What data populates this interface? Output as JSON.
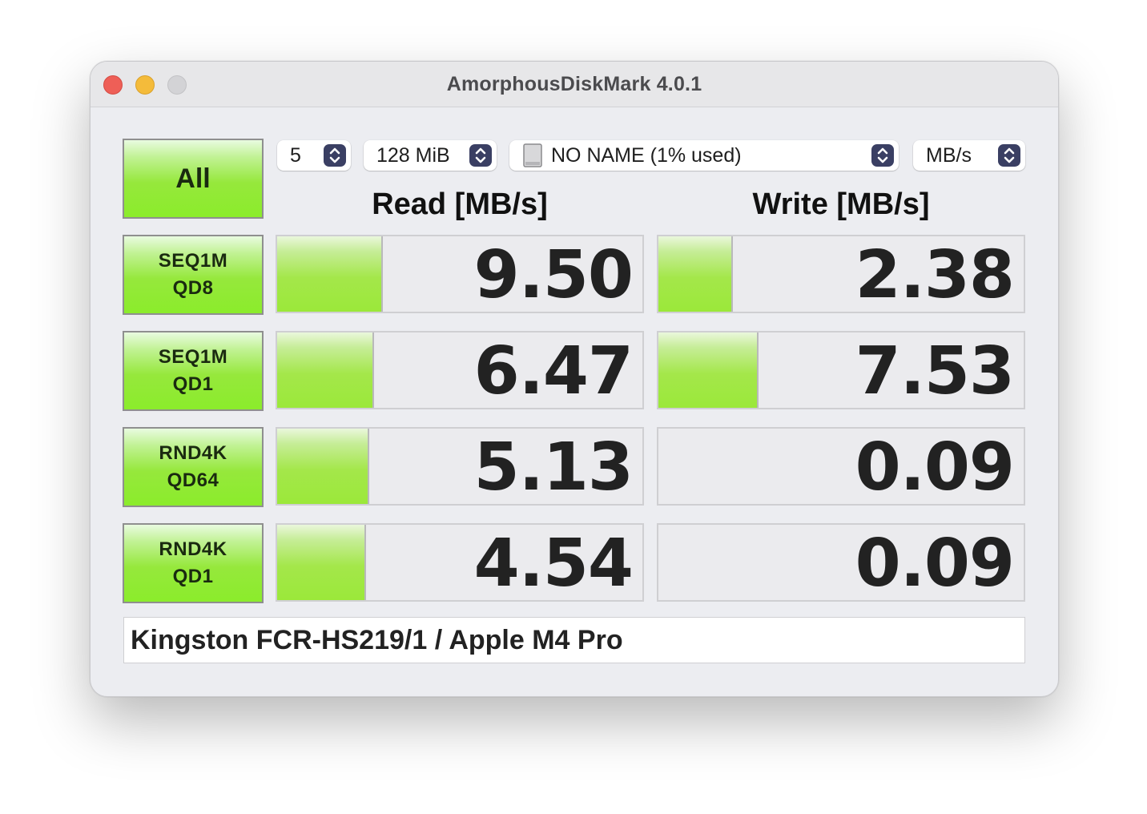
{
  "window": {
    "title": "AmorphousDiskMark 4.0.1"
  },
  "controls": {
    "all_label": "All",
    "count": "5",
    "size": "128 MiB",
    "drive": "NO NAME (1% used)",
    "unit": "MB/s"
  },
  "headers": {
    "read": "Read [MB/s]",
    "write": "Write [MB/s]"
  },
  "tests": [
    {
      "line1": "SEQ1M",
      "line2": "QD8",
      "read": "9.50",
      "write": "2.38",
      "read_fill": 0.285,
      "write_fill": 0.2
    },
    {
      "line1": "SEQ1M",
      "line2": "QD1",
      "read": "6.47",
      "write": "7.53",
      "read_fill": 0.262,
      "write_fill": 0.27
    },
    {
      "line1": "RND4K",
      "line2": "QD64",
      "read": "5.13",
      "write": "0.09",
      "read_fill": 0.248,
      "write_fill": 0.0
    },
    {
      "line1": "RND4K",
      "line2": "QD1",
      "read": "4.54",
      "write": "0.09",
      "read_fill": 0.24,
      "write_fill": 0.0
    }
  ],
  "footer": {
    "text": "Kingston FCR-HS219/1 / Apple M4 Pro"
  },
  "colors": {
    "accent_green": "#96e83c",
    "stepper": "#3a3f63"
  }
}
